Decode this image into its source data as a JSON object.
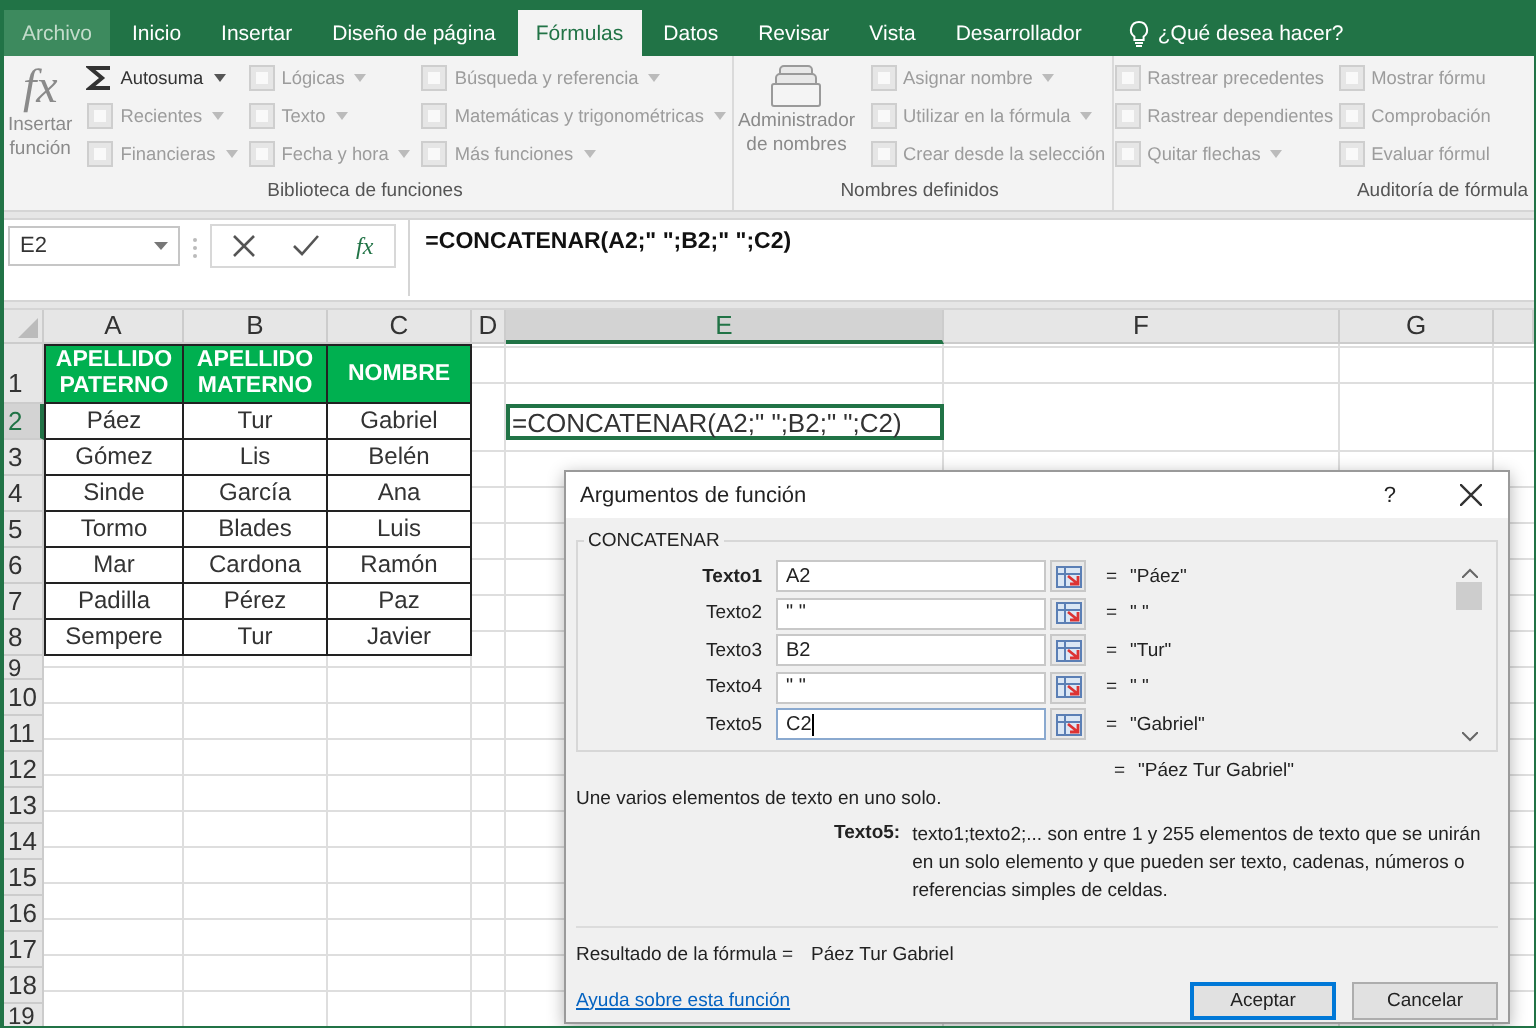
{
  "tabs": [
    {
      "label": "Archivo",
      "selected": false,
      "disabled": true
    },
    {
      "label": "Inicio",
      "selected": false,
      "disabled": false
    },
    {
      "label": "Insertar",
      "selected": false,
      "disabled": false
    },
    {
      "label": "Diseño de página",
      "selected": false,
      "disabled": false
    },
    {
      "label": "Fórmulas",
      "selected": true,
      "disabled": false
    },
    {
      "label": "Datos",
      "selected": false,
      "disabled": false
    },
    {
      "label": "Revisar",
      "selected": false,
      "disabled": false
    },
    {
      "label": "Vista",
      "selected": false,
      "disabled": false
    },
    {
      "label": "Desarrollador",
      "selected": false,
      "disabled": false
    }
  ],
  "tell_me": {
    "label": "¿Qué desea hacer?"
  },
  "ribbon": {
    "groups": [
      {
        "label": "Biblioteca de funciones",
        "large": {
          "glyph": "fx",
          "lines": [
            "Insertar",
            "función"
          ],
          "disabled": true
        },
        "columns": [
          [
            {
              "label": "Autosuma",
              "disabled": false,
              "dropdown": true
            },
            {
              "label": "Recientes",
              "disabled": true,
              "dropdown": true
            },
            {
              "label": "Financieras",
              "disabled": true,
              "dropdown": true
            }
          ],
          [
            {
              "label": "Lógicas",
              "disabled": true,
              "dropdown": true
            },
            {
              "label": "Texto",
              "disabled": true,
              "dropdown": true
            },
            {
              "label": "Fecha y hora",
              "disabled": true,
              "dropdown": true
            }
          ],
          [
            {
              "label": "Búsqueda y referencia",
              "disabled": true,
              "dropdown": true
            },
            {
              "label": "Matemáticas y trigonométricas",
              "disabled": true,
              "dropdown": true
            },
            {
              "label": "Más funciones",
              "disabled": true,
              "dropdown": true
            }
          ]
        ]
      },
      {
        "label": "Nombres definidos",
        "large": {
          "lines": [
            "Administrador",
            "de nombres"
          ],
          "disabled": true
        },
        "columns": [
          [
            {
              "label": "Asignar nombre",
              "disabled": true,
              "dropdown": true
            },
            {
              "label": "Utilizar en la fórmula",
              "disabled": true,
              "dropdown": true
            },
            {
              "label": "Crear desde la selección",
              "disabled": true,
              "dropdown": false
            }
          ]
        ]
      },
      {
        "label": "Auditoría de fórmula",
        "columns": [
          [
            {
              "label": "Rastrear precedentes",
              "disabled": true,
              "dropdown": false
            },
            {
              "label": "Rastrear dependientes",
              "disabled": true,
              "dropdown": false
            },
            {
              "label": "Quitar flechas",
              "disabled": true,
              "dropdown": true
            }
          ],
          [
            {
              "label": "Mostrar fórmu",
              "disabled": true,
              "dropdown": false
            },
            {
              "label": "Comprobación",
              "disabled": true,
              "dropdown": false
            },
            {
              "label": "Evaluar fórmul",
              "disabled": true,
              "dropdown": false
            }
          ]
        ]
      }
    ]
  },
  "formula_bar": {
    "name_box": "E2",
    "fx": "fx",
    "formula": "=CONCATENAR(A2;\" \";B2;\" \";C2)"
  },
  "sheet": {
    "columns": [
      {
        "label": "A",
        "selected": false
      },
      {
        "label": "B",
        "selected": false
      },
      {
        "label": "C",
        "selected": false
      },
      {
        "label": "D",
        "selected": false
      },
      {
        "label": "E",
        "selected": true
      },
      {
        "label": "F",
        "selected": false
      },
      {
        "label": "G",
        "selected": false
      }
    ],
    "rows": [
      {
        "label": "1",
        "selected": false
      },
      {
        "label": "2",
        "selected": true
      },
      {
        "label": "3",
        "selected": false
      },
      {
        "label": "4",
        "selected": false
      },
      {
        "label": "5",
        "selected": false
      },
      {
        "label": "6",
        "selected": false
      },
      {
        "label": "7",
        "selected": false
      },
      {
        "label": "8",
        "selected": false
      },
      {
        "label": "9",
        "selected": false
      },
      {
        "label": "10",
        "selected": false
      },
      {
        "label": "11",
        "selected": false
      },
      {
        "label": "12",
        "selected": false
      },
      {
        "label": "13",
        "selected": false
      },
      {
        "label": "14",
        "selected": false
      },
      {
        "label": "15",
        "selected": false
      },
      {
        "label": "16",
        "selected": false
      },
      {
        "label": "17",
        "selected": false
      },
      {
        "label": "18",
        "selected": false
      },
      {
        "label": "19",
        "selected": false
      }
    ],
    "table": {
      "header": [
        "APELLIDO PATERNO",
        "APELLIDO MATERNO",
        "NOMBRE"
      ],
      "rows": [
        [
          "Páez",
          "Tur",
          "Gabriel"
        ],
        [
          "Gómez",
          "Lis",
          "Belén"
        ],
        [
          "Sinde",
          "García",
          "Ana"
        ],
        [
          "Tormo",
          "Blades",
          "Luis"
        ],
        [
          "Mar",
          "Cardona",
          "Ramón"
        ],
        [
          "Padilla",
          "Pérez",
          "Paz"
        ],
        [
          "Sempere",
          "Tur",
          "Javier"
        ]
      ]
    },
    "active_cell_text": "=CONCATENAR(A2;\" \";B2;\" \";C2)"
  },
  "dialog": {
    "title": "Argumentos de función",
    "help": "?",
    "function_name": "CONCATENAR",
    "args": [
      {
        "label": "Texto1",
        "value": "A2",
        "equals": "=",
        "result": "\"Páez\"",
        "required": true,
        "focused": false
      },
      {
        "label": "Texto2",
        "value": "\" \"",
        "equals": "=",
        "result": "\" \"",
        "required": false,
        "focused": false
      },
      {
        "label": "Texto3",
        "value": "B2",
        "equals": "=",
        "result": "\"Tur\"",
        "required": false,
        "focused": false
      },
      {
        "label": "Texto4",
        "value": "\" \"",
        "equals": "=",
        "result": "\" \"",
        "required": false,
        "focused": false
      },
      {
        "label": "Texto5",
        "value": "C2",
        "equals": "=",
        "result": "\"Gabriel\"",
        "required": false,
        "focused": true
      }
    ],
    "total": {
      "equals": "=",
      "value": "\"Páez Tur Gabriel\""
    },
    "description": "Une varios elementos de texto en uno solo.",
    "arg_help": {
      "label": "Texto5:",
      "text": "texto1;texto2;... son entre 1 y 255 elementos de texto que se unirán en un solo elemento y que pueden ser texto, cadenas, números o referencias simples de celdas."
    },
    "result_label": "Resultado de la fórmula =",
    "result_value": "Páez Tur Gabriel",
    "help_link": "Ayuda sobre esta función",
    "buttons": [
      {
        "label": "Aceptar",
        "default": true
      },
      {
        "label": "Cancelar",
        "default": false
      }
    ]
  }
}
